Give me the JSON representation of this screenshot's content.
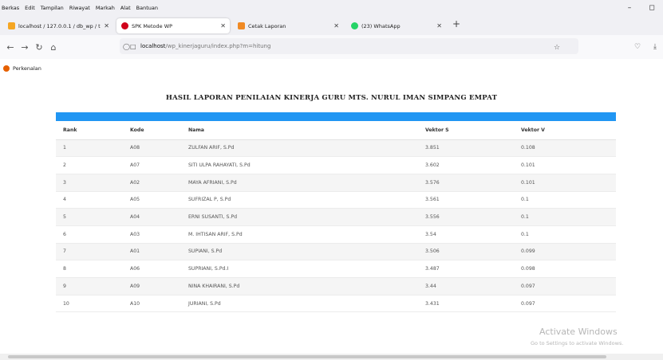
{
  "menu": [
    "Berkas",
    "Edit",
    "Tampilan",
    "Riwayat",
    "Markah",
    "Alat",
    "Bantuan"
  ],
  "tabs": [
    {
      "label": "localhost / 127.0.0.1 / db_wp / t",
      "icon": "phpmyadmin-icon"
    },
    {
      "label": "SPK Metode WP",
      "icon": "site-icon"
    },
    {
      "label": "Cetak Laporan",
      "icon": "page-icon"
    },
    {
      "label": "(23) WhatsApp",
      "icon": "whatsapp-icon"
    }
  ],
  "url": {
    "host": "localhost",
    "path": "/wp_kinerjaguru/index.php?m=hitung"
  },
  "bookmarks": {
    "item": "Perkenalan"
  },
  "report": {
    "title": "HASIL LAPORAN PENILAIAN KINERJA GURU MTS. NURUL IMAN SIMPANG EMPAT",
    "headers": [
      "Rank",
      "Kode",
      "Nama",
      "Vektor S",
      "Vektor V"
    ],
    "rows": [
      [
        "1",
        "A08",
        "ZULFAN ARIF, S.Pd",
        "3.851",
        "0.108"
      ],
      [
        "2",
        "A07",
        "SITI ULPA RAHAYATI, S.Pd",
        "3.602",
        "0.101"
      ],
      [
        "3",
        "A02",
        "MAYA AFRIANI, S.Pd",
        "3.576",
        "0.101"
      ],
      [
        "4",
        "A05",
        "SUFRIZAL P, S.Pd",
        "3.561",
        "0.1"
      ],
      [
        "5",
        "A04",
        "ERNI SUSANTI, S.Pd",
        "3.556",
        "0.1"
      ],
      [
        "6",
        "A03",
        "M. IHTISAN ARIF, S.Pd",
        "3.54",
        "0.1"
      ],
      [
        "7",
        "A01",
        "SUPIANI, S.Pd",
        "3.506",
        "0.099"
      ],
      [
        "8",
        "A06",
        "SUPRIANI, S.Pd.I",
        "3.487",
        "0.098"
      ],
      [
        "9",
        "A09",
        "NINA KHAIRANI, S.Pd",
        "3.44",
        "0.097"
      ],
      [
        "10",
        "A10",
        "JURIANI, S.Pd",
        "3.431",
        "0.097"
      ]
    ]
  },
  "watermark": {
    "line1": "Activate Windows",
    "line2": "Go to Settings to activate Windows."
  },
  "colors": {
    "accent": "#2196f3"
  }
}
